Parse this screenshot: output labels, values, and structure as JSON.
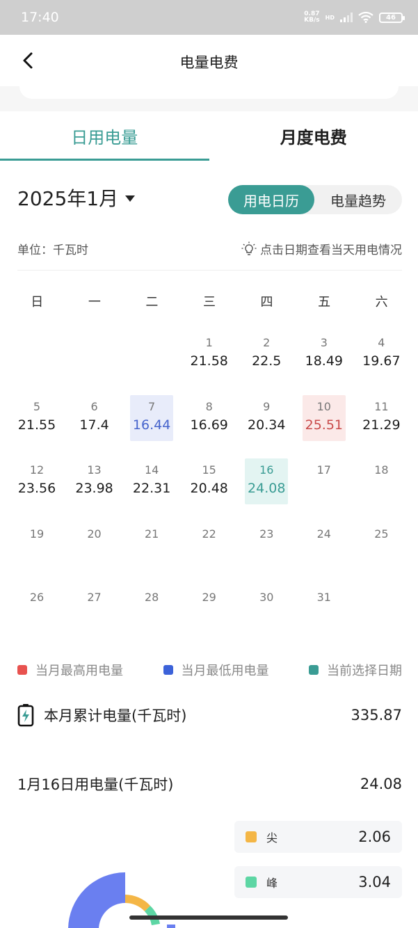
{
  "status": {
    "time": "17:40",
    "speed_top": "0.87",
    "speed_bottom": "KB/s",
    "hd": "HD",
    "battery": "46"
  },
  "header": {
    "title": "电量电费"
  },
  "tabs": [
    {
      "label": "日用电量",
      "active": true
    },
    {
      "label": "月度电费",
      "active": false
    }
  ],
  "month": {
    "label": "2025年1月"
  },
  "segment": {
    "calendar": "用电日历",
    "trend": "电量趋势"
  },
  "unit": "单位：千瓦时",
  "hint": "点击日期查看当天用电情况",
  "weekdays": [
    "日",
    "一",
    "二",
    "三",
    "四",
    "五",
    "六"
  ],
  "calendar": [
    [
      {
        "day": "",
        "value": ""
      },
      {
        "day": "",
        "value": ""
      },
      {
        "day": "",
        "value": ""
      },
      {
        "day": "1",
        "value": "21.58"
      },
      {
        "day": "2",
        "value": "22.5"
      },
      {
        "day": "3",
        "value": "18.49"
      },
      {
        "day": "4",
        "value": "19.67"
      }
    ],
    [
      {
        "day": "5",
        "value": "21.55"
      },
      {
        "day": "6",
        "value": "17.4"
      },
      {
        "day": "7",
        "value": "16.44",
        "mark": "low"
      },
      {
        "day": "8",
        "value": "16.69"
      },
      {
        "day": "9",
        "value": "20.34"
      },
      {
        "day": "10",
        "value": "25.51",
        "mark": "high"
      },
      {
        "day": "11",
        "value": "21.29"
      }
    ],
    [
      {
        "day": "12",
        "value": "23.56"
      },
      {
        "day": "13",
        "value": "23.98"
      },
      {
        "day": "14",
        "value": "22.31"
      },
      {
        "day": "15",
        "value": "20.48"
      },
      {
        "day": "16",
        "value": "24.08",
        "mark": "sel"
      },
      {
        "day": "17",
        "value": ""
      },
      {
        "day": "18",
        "value": ""
      }
    ],
    [
      {
        "day": "19",
        "value": ""
      },
      {
        "day": "20",
        "value": ""
      },
      {
        "day": "21",
        "value": ""
      },
      {
        "day": "22",
        "value": ""
      },
      {
        "day": "23",
        "value": ""
      },
      {
        "day": "24",
        "value": ""
      },
      {
        "day": "25",
        "value": ""
      }
    ],
    [
      {
        "day": "26",
        "value": ""
      },
      {
        "day": "27",
        "value": ""
      },
      {
        "day": "28",
        "value": ""
      },
      {
        "day": "29",
        "value": ""
      },
      {
        "day": "30",
        "value": ""
      },
      {
        "day": "31",
        "value": ""
      },
      {
        "day": "",
        "value": ""
      }
    ]
  ],
  "legend": [
    {
      "label": "当月最高用电量",
      "color": "#e8524f"
    },
    {
      "label": "当月最低用电量",
      "color": "#3c62d9"
    },
    {
      "label": "当前选择日期",
      "color": "#3a9c94"
    }
  ],
  "summary": {
    "total_label": "本月累计电量(千瓦时)",
    "total_value": "335.87",
    "day_label": "1月16日用电量(千瓦时)",
    "day_value": "24.08"
  },
  "breakdown": [
    {
      "name": "尖",
      "value": "2.06",
      "color": "#f4b646"
    },
    {
      "name": "峰",
      "value": "3.04",
      "color": "#5dd6a4"
    }
  ],
  "colors": {
    "accent": "#3a9c94",
    "donut_main": "#6a7ff0"
  }
}
